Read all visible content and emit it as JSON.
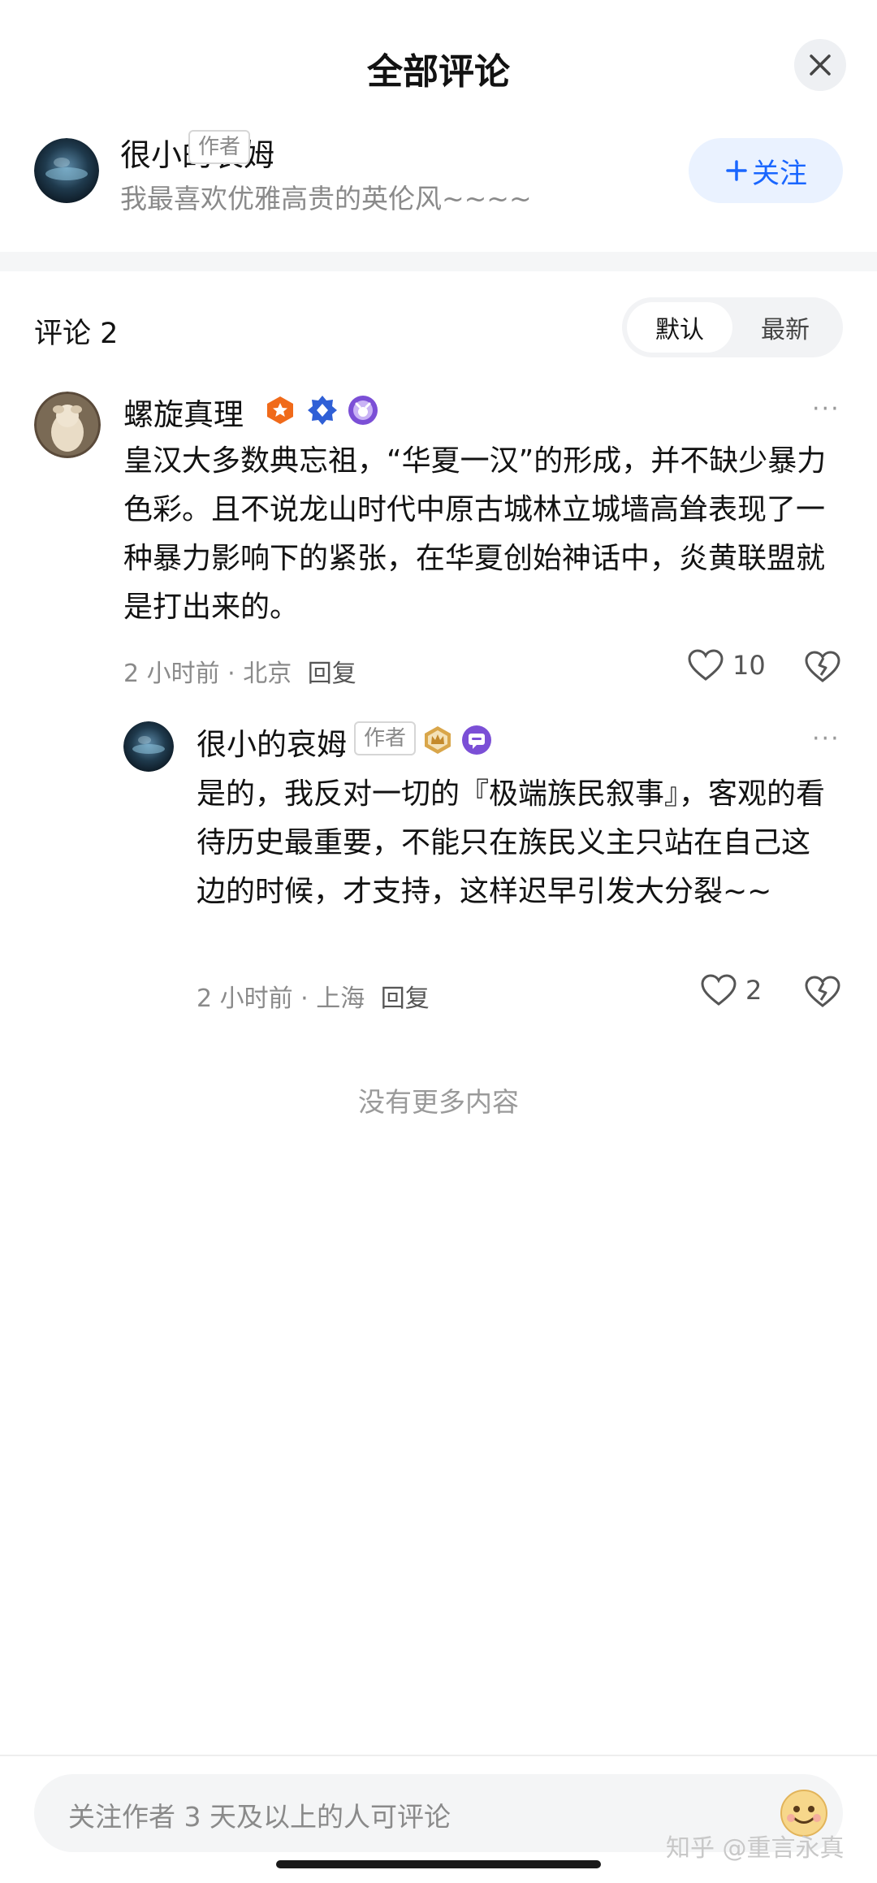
{
  "header": {
    "title": "全部评论"
  },
  "author": {
    "name": "很小的哀姆",
    "tag": "作者",
    "subtitle": "我最喜欢优雅高贵的英伦风~~~~",
    "follow_label": "关注"
  },
  "comments_section": {
    "count_label": "评论 2",
    "sort_options": [
      "默认",
      "最新"
    ],
    "active_sort": "默认"
  },
  "comments": [
    {
      "name": "螺旋真理",
      "body": "皇汉大多数典忘祖，“华夏一汉”的形成，并不缺少暴力色彩。且不说龙山时代中原古城林立城墙高耸表现了一种暴力影响下的紧张，在华夏创始神话中，炎黄联盟就是打出来的。",
      "time": "2 小时前",
      "location": "北京",
      "reply_label": "回复",
      "likes": "10",
      "badges": [
        "orange-star-badge",
        "blue-diamond-badge",
        "purple-badge"
      ]
    },
    {
      "name": "很小的哀姆",
      "tag": "作者",
      "body": "是的，我反对一切的『极端族民叙事』，客观的看待历史最重要，不能只在族民义主只站在自己这边的时候，才支持，这样迟早引发大分裂~~",
      "time": "2 小时前",
      "location": "上海",
      "reply_label": "回复",
      "likes": "2",
      "badges": [
        "gold-crown-badge",
        "purple-chat-badge"
      ]
    }
  ],
  "footer": {
    "no_more": "没有更多内容",
    "input_placeholder": "关注作者 3 天及以上的人可评论",
    "watermark": "知乎 @重言永真"
  },
  "colors": {
    "accent": "#1966ff",
    "follow_bg": "#eaf2ff",
    "muted_text": "#8a8a8a"
  }
}
